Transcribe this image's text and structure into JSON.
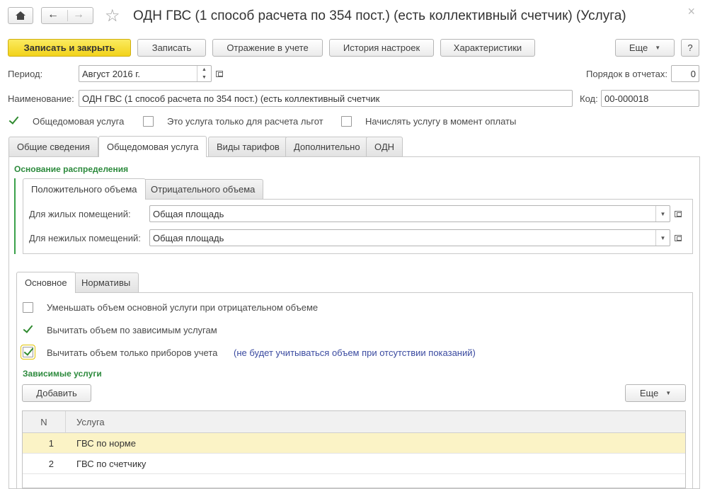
{
  "window": {
    "title": "ОДН ГВС (1 способ расчета по 354 пост.) (есть коллективный счетчик) (Услуга)"
  },
  "toolbar": {
    "save_close": "Записать и закрыть",
    "save": "Записать",
    "accounting": "Отражение в учете",
    "history": "История настроек",
    "characteristics": "Характеристики",
    "more": "Еще",
    "help": "?"
  },
  "form": {
    "period_label": "Период:",
    "period_value": "Август 2016 г.",
    "order_label": "Порядок в отчетах:",
    "order_value": "0",
    "name_label": "Наименование:",
    "name_value": "ОДН ГВС (1 способ расчета по 354 пост.) (есть коллективный счетчик",
    "code_label": "Код:",
    "code_value": "00-000018",
    "cb_common": "Общедомовая услуга",
    "cb_benefit": "Это услуга только для расчета льгот",
    "cb_payment": "Начислять услугу в момент оплаты"
  },
  "tabs": [
    "Общие сведения",
    "Общедомовая услуга",
    "Виды тарифов",
    "Дополнительно",
    "ОДН"
  ],
  "distribution": {
    "title": "Основание распределения",
    "tabs": [
      "Положительного объема",
      "Отрицательного объема"
    ],
    "residential_label": "Для жилых помещений:",
    "residential_value": "Общая площадь",
    "nonresidential_label": "Для нежилых помещений:",
    "nonresidential_value": "Общая площадь"
  },
  "subtabs": [
    "Основное",
    "Нормативы"
  ],
  "options": {
    "reduce": "Уменьшать объем основной услуги при отрицательном объеме",
    "subtract_dependent": "Вычитать объем по зависимым услугам",
    "subtract_meters": "Вычитать объем только приборов учета",
    "meters_note": "(не будет учитываться объем при отсутствии показаний)"
  },
  "dependent": {
    "title": "Зависимые услуги",
    "add": "Добавить",
    "more": "Еще",
    "columns": {
      "n": "N",
      "service": "Услуга"
    },
    "rows": [
      {
        "n": "1",
        "service": "ГВС по норме"
      },
      {
        "n": "2",
        "service": "ГВС по счетчику"
      }
    ]
  },
  "colors": {
    "accent_green": "#2c8a3c",
    "primary_button": "#f2d21a",
    "selected_row": "#fbf3c6",
    "note_blue": "#3a4aa0"
  }
}
